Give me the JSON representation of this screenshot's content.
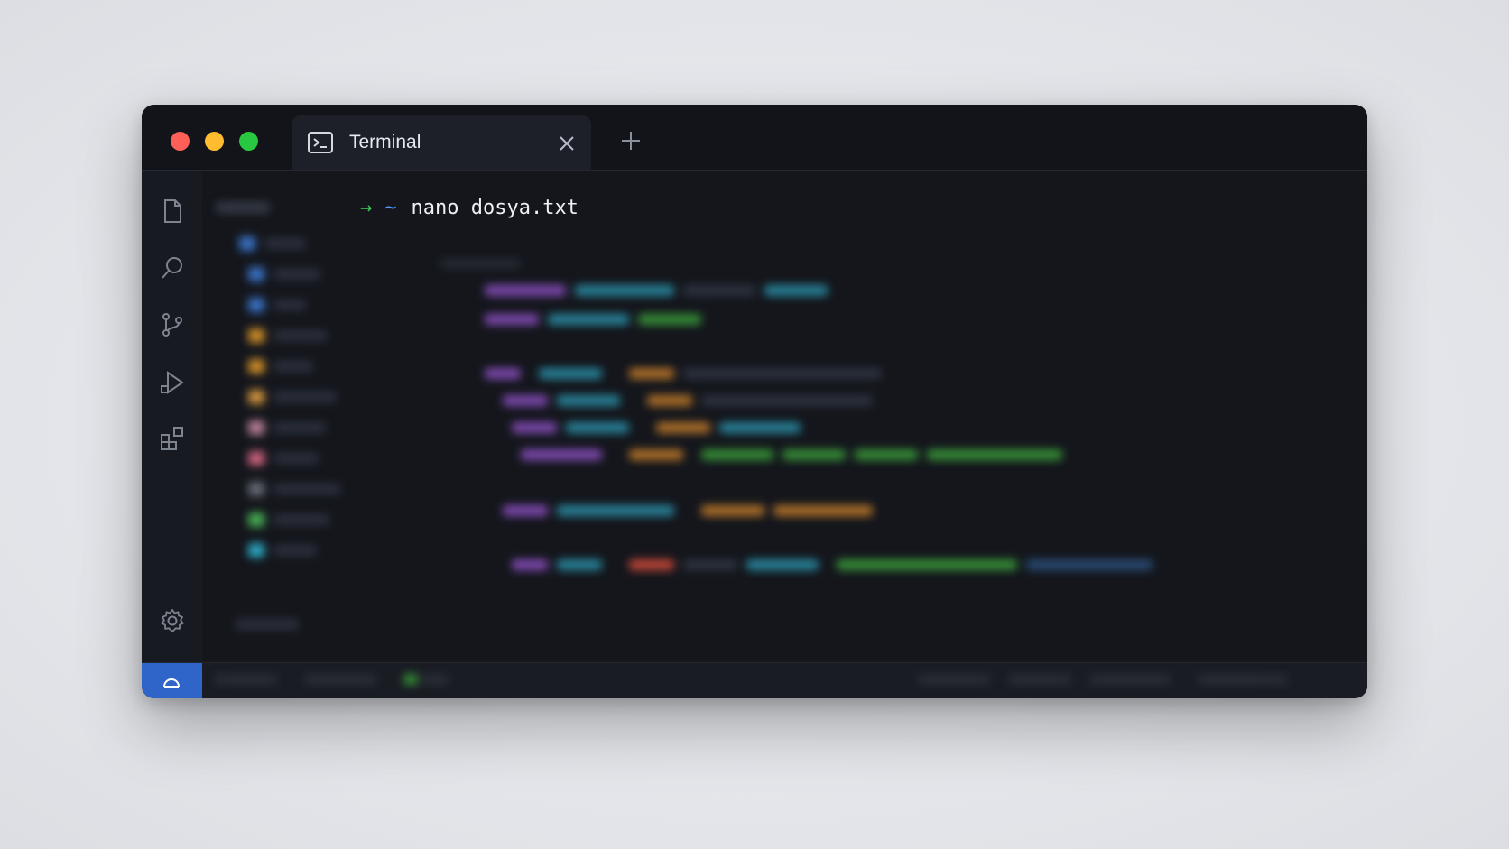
{
  "window": {
    "tab_title": "Terminal",
    "tab_icon": "terminal-icon",
    "close_icon": "close-icon",
    "new_tab_icon": "plus-icon"
  },
  "activity_bar": {
    "items": [
      "files-icon",
      "search-icon",
      "source-control-icon",
      "run-debug-icon",
      "extensions-icon"
    ],
    "bottom": "gear-icon"
  },
  "terminal": {
    "prompt_arrow": "→",
    "cwd": "~",
    "command": "nano dosya.txt"
  },
  "colors": {
    "background": "#14161c",
    "accent": "#2f64c8",
    "prompt_arrow": "#3fcf5a",
    "cwd": "#4a9fff",
    "traffic_red": "#fe5f57",
    "traffic_yellow": "#febc2e",
    "traffic_green": "#28c840"
  }
}
